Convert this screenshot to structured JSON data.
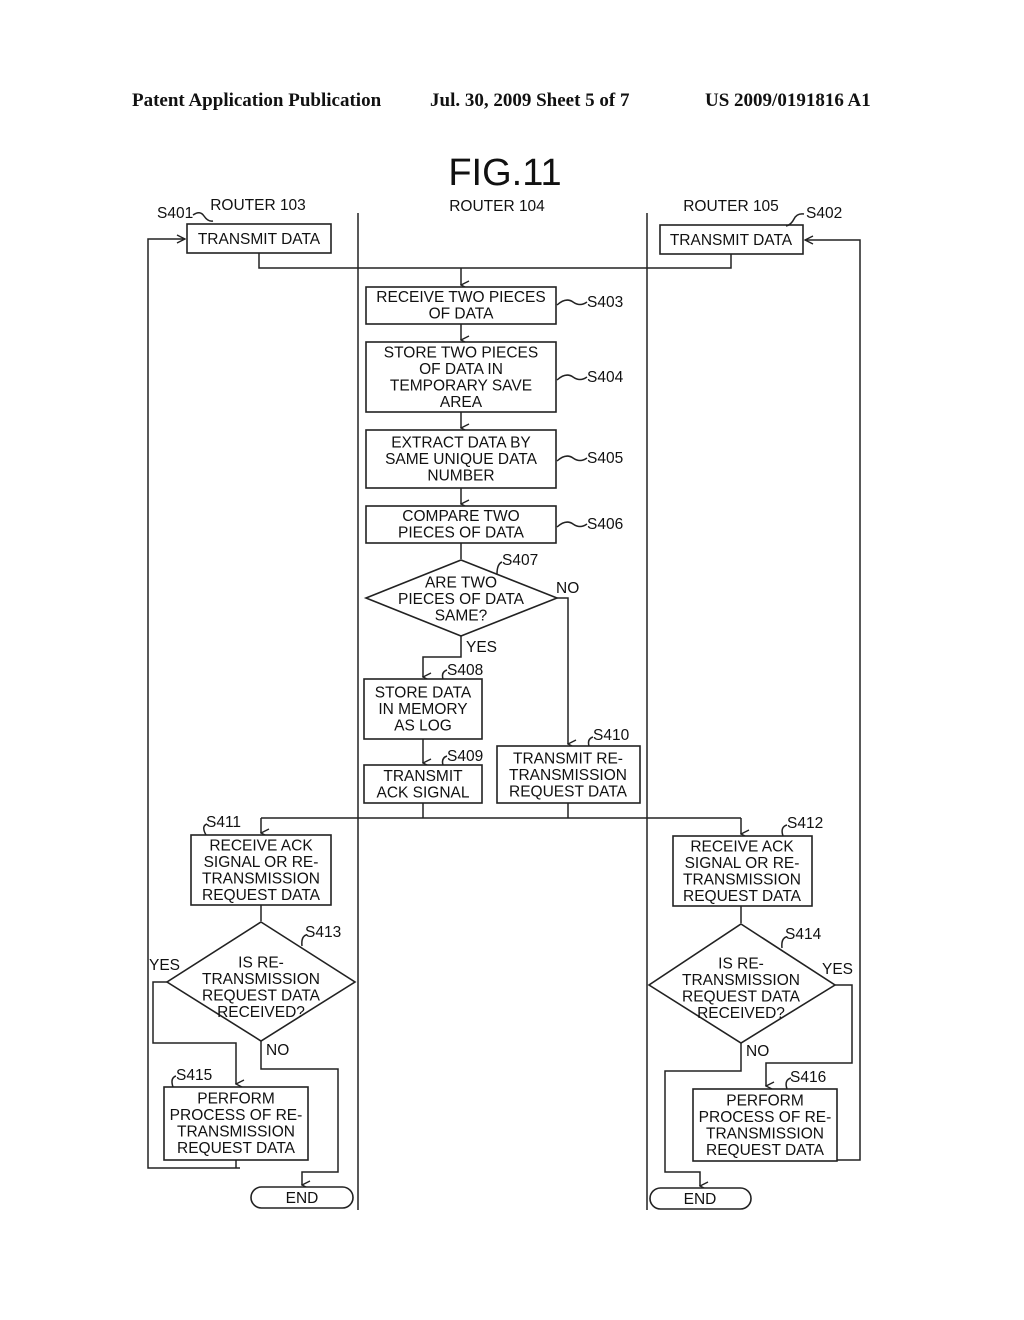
{
  "header": {
    "left": "Patent Application Publication",
    "center": "Jul. 30, 2009   Sheet 5 of 7",
    "right": "US 2009/0191816 A1"
  },
  "figure": {
    "title": "FIG.11",
    "lanes": [
      "ROUTER 103",
      "ROUTER 104",
      "ROUTER 105"
    ],
    "steps": {
      "S401": {
        "id": "S401",
        "lines": [
          "TRANSMIT DATA"
        ]
      },
      "S402": {
        "id": "S402",
        "lines": [
          "TRANSMIT DATA"
        ]
      },
      "S403": {
        "id": "S403",
        "lines": [
          "RECEIVE TWO PIECES",
          "OF DATA"
        ]
      },
      "S404": {
        "id": "S404",
        "lines": [
          "STORE TWO PIECES",
          "OF DATA IN",
          "TEMPORARY SAVE",
          "AREA"
        ]
      },
      "S405": {
        "id": "S405",
        "lines": [
          "EXTRACT DATA BY",
          "SAME UNIQUE DATA",
          "NUMBER"
        ]
      },
      "S406": {
        "id": "S406",
        "lines": [
          "COMPARE TWO",
          "PIECES OF DATA"
        ]
      },
      "S407": {
        "id": "S407",
        "lines": [
          "ARE TWO",
          "PIECES OF DATA",
          "SAME?"
        ]
      },
      "S408": {
        "id": "S408",
        "lines": [
          "STORE DATA",
          "IN MEMORY",
          "AS LOG"
        ]
      },
      "S409": {
        "id": "S409",
        "lines": [
          "TRANSMIT",
          "ACK SIGNAL"
        ]
      },
      "S410": {
        "id": "S410",
        "lines": [
          "TRANSMIT RE-",
          "TRANSMISSION",
          "REQUEST DATA"
        ]
      },
      "S411": {
        "id": "S411",
        "lines": [
          "RECEIVE ACK",
          "SIGNAL OR RE-",
          "TRANSMISSION",
          "REQUEST DATA"
        ]
      },
      "S412": {
        "id": "S412",
        "lines": [
          "RECEIVE ACK",
          "SIGNAL OR RE-",
          "TRANSMISSION",
          "REQUEST DATA"
        ]
      },
      "S413": {
        "id": "S413",
        "lines": [
          "IS RE-",
          "TRANSMISSION",
          "REQUEST DATA",
          "RECEIVED?"
        ]
      },
      "S414": {
        "id": "S414",
        "lines": [
          "IS RE-",
          "TRANSMISSION",
          "REQUEST DATA",
          "RECEIVED?"
        ]
      },
      "S415": {
        "id": "S415",
        "lines": [
          "PERFORM",
          "PROCESS OF RE-",
          "TRANSMISSION",
          "REQUEST DATA"
        ]
      },
      "S416": {
        "id": "S416",
        "lines": [
          "PERFORM",
          "PROCESS OF RE-",
          "TRANSMISSION",
          "REQUEST DATA"
        ]
      }
    },
    "branch_labels": {
      "yes": "YES",
      "no": "NO"
    },
    "terminals": {
      "end": "END"
    }
  }
}
